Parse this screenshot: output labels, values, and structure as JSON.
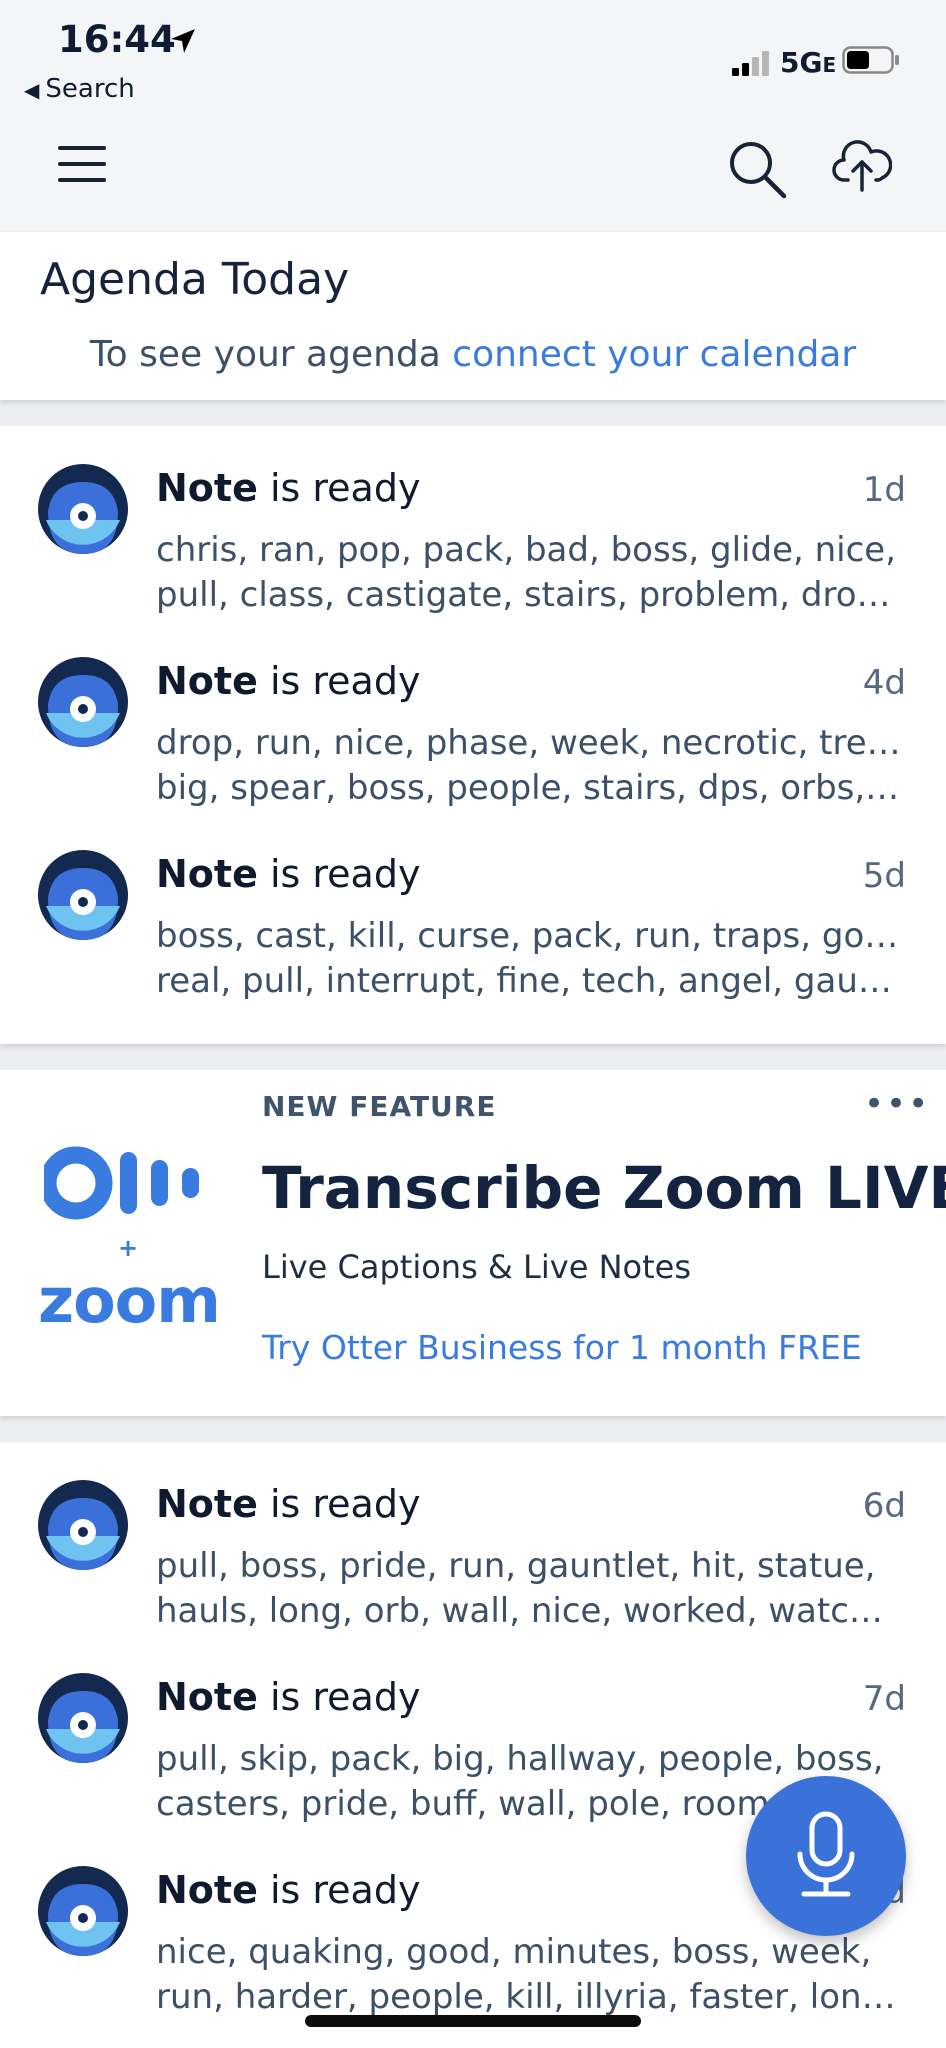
{
  "status_bar": {
    "time": "16:44",
    "back_label": "Search",
    "network": "5G",
    "network_suffix": "E"
  },
  "agenda": {
    "title": "Agenda Today",
    "prompt": "To see your agenda",
    "link": "connect your calendar"
  },
  "notes": [
    {
      "title": "Note",
      "status": "is ready",
      "age": "1d",
      "keywords_line1": "chris, ran, pop, pack, bad, boss, glide, nice,",
      "keywords_line2": "pull, class, castigate, stairs, problem, drop,..."
    },
    {
      "title": "Note",
      "status": "is ready",
      "age": "4d",
      "keywords_line1": "drop, run, nice, phase, week, necrotic, trees,",
      "keywords_line2": "big, spear, boss, people, stairs, dps, orbs, gl..."
    },
    {
      "title": "Note",
      "status": "is ready",
      "age": "5d",
      "keywords_line1": "boss, cast, kill, curse, pack, run, traps, good,",
      "keywords_line2": "real, pull, interrupt, fine, tech, angel, gauntl..."
    },
    {
      "title": "Note",
      "status": "is ready",
      "age": "6d",
      "keywords_line1": "pull, boss, pride, run, gauntlet, hit, statue,",
      "keywords_line2": "hauls, long, orb, wall, nice, worked, watch,..."
    },
    {
      "title": "Note",
      "status": "is ready",
      "age": "7d",
      "keywords_line1": "pull, skip, pack, big, hallway, people, boss,",
      "keywords_line2": "casters, pride, buff, wall, pole, room, s..."
    },
    {
      "title": "Note",
      "status": "is ready",
      "age": "8d",
      "keywords_line1": "nice, quaking, good, minutes, boss, week,",
      "keywords_line2": "run, harder, people, kill, illyria, faster, long,..."
    }
  ],
  "promo": {
    "badge": "NEW FEATURE",
    "more": "•••",
    "title": "Transcribe Zoom LIVE",
    "subtitle": "Live Captions & Live Notes",
    "cta": "Try Otter Business for 1 month FREE",
    "plus": "+",
    "zoom_logo": "zoom"
  },
  "colors": {
    "accent": "#3a7be0",
    "fab": "#3a72d9",
    "avatar_dark": "#14294f",
    "avatar_light": "#6fc3f0",
    "text_primary": "#101a2e",
    "text_secondary": "#3c5068"
  },
  "icons": {
    "menu": "menu-icon",
    "search": "search-icon",
    "upload": "cloud-upload-icon",
    "mic": "microphone-icon",
    "avatar": "otter-avatar-icon"
  }
}
